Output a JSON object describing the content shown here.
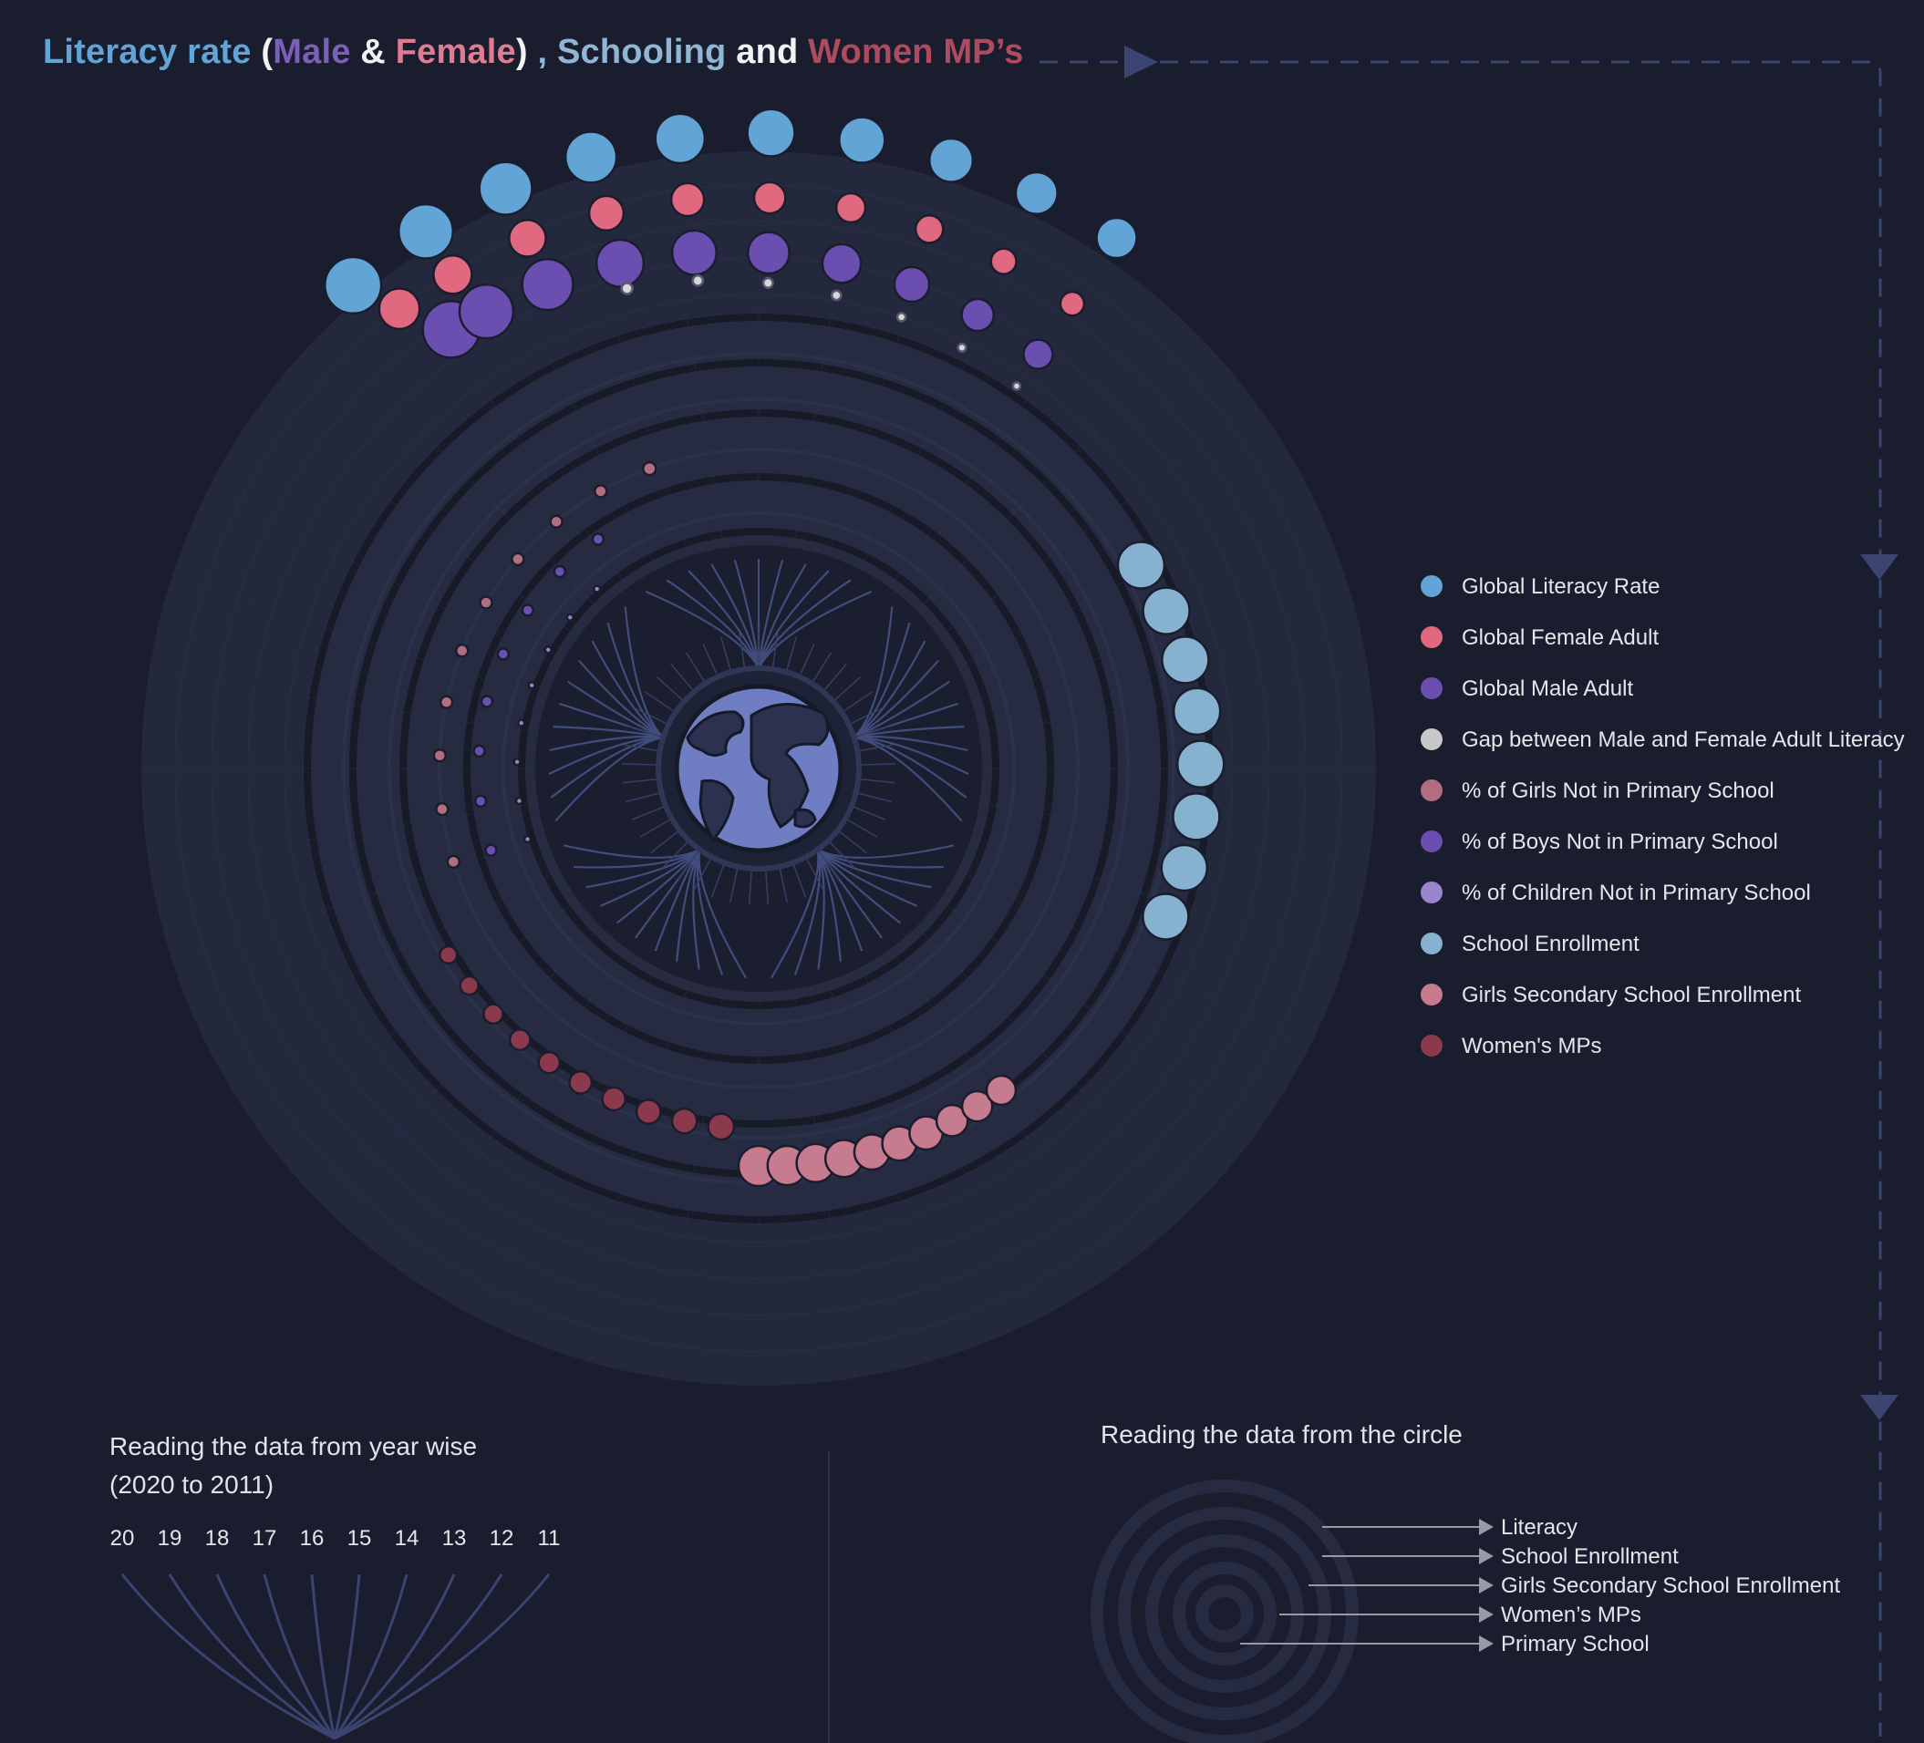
{
  "title": {
    "part1": "Literacy rate",
    "open": " (",
    "male": "Male",
    "amp": " & ",
    "female": "Female",
    "close": ")",
    "comma": " , ",
    "schooling": "Schooling",
    "and": " and ",
    "mps": "Women MP’s"
  },
  "colors": {
    "background": "#1a1d2d",
    "literacy": "#63a4d6",
    "female": "#e0697f",
    "male": "#6a4fb0",
    "gap": "#c8c8c8",
    "girls_not_primary": "#b36d80",
    "boys_not_primary": "#6a4fb0",
    "children_not_primary": "#9b85cf",
    "school_enrollment": "#86b2cf",
    "girls_secondary": "#c77b8e",
    "women_mps": "#8a3a4c",
    "ring": "#262b40"
  },
  "legend": [
    {
      "label": "Global Literacy Rate",
      "color": "#63a4d6"
    },
    {
      "label": "Global Female Adult",
      "color": "#e0697f"
    },
    {
      "label": "Global Male Adult",
      "color": "#6a4fb0"
    },
    {
      "label": "Gap between Male and Female  Adult Literacy",
      "color": "#c8c8c8"
    },
    {
      "label": "% of Girls Not in Primary School",
      "color": "#b36d80"
    },
    {
      "label": "% of Boys Not in Primary School",
      "color": "#6a4fb0"
    },
    {
      "label": "% of Children Not in Primary School",
      "color": "#9b85cf"
    },
    {
      "label": "School Enrollment",
      "color": "#86b2cf"
    },
    {
      "label": "Girls Secondary School Enrollment",
      "color": "#c77b8e"
    },
    {
      "label": "Women's MPs",
      "color": "#8a3a4c"
    }
  ],
  "chart_data": {
    "type": "radial-bubble",
    "years": [
      "2020",
      "2019",
      "2018",
      "2017",
      "2016",
      "2015",
      "2014",
      "2013",
      "2012",
      "2011"
    ],
    "series": [
      {
        "name": "Global Literacy Rate",
        "values": [
          87,
          86,
          86,
          86,
          86,
          85,
          85,
          84,
          84,
          84
        ]
      },
      {
        "name": "Global Female Adult",
        "values": [
          83,
          82,
          82,
          81,
          81,
          81,
          80,
          80,
          79,
          79
        ]
      },
      {
        "name": "Global Male Adult",
        "values": [
          90,
          90,
          90,
          89,
          89,
          89,
          89,
          88,
          88,
          88
        ]
      },
      {
        "name": "Gap between Male and Female  Adult Literacy",
        "values": [
          7,
          8,
          8,
          8,
          8,
          8,
          9,
          8,
          9,
          9
        ]
      },
      {
        "name": "% of Girls Not in Primary School",
        "values": [
          9,
          9,
          9,
          9,
          9,
          9,
          9,
          9,
          9,
          10
        ]
      },
      {
        "name": "% of Boys Not in Primary School",
        "values": [
          8,
          8,
          8,
          8,
          8,
          8,
          8,
          8,
          8,
          8
        ]
      },
      {
        "name": "% of Children Not in Primary School",
        "values": [
          8,
          8,
          8,
          8,
          8,
          8,
          8,
          8,
          8,
          9
        ]
      },
      {
        "name": "School Enrollment",
        "values": [
          90,
          90,
          90,
          90,
          90,
          90,
          89,
          89,
          89,
          89
        ]
      },
      {
        "name": "Girls Secondary School Enrollment",
        "values": [
          76,
          75,
          74,
          73,
          71,
          70,
          69,
          67,
          66,
          65
        ]
      },
      {
        "name": "Women's MPs",
        "values": [
          25,
          24,
          24,
          23,
          23,
          22,
          22,
          21,
          20,
          19
        ]
      }
    ]
  },
  "guide_left": {
    "title_line1": "Reading the data from year wise",
    "title_line2": "(2020 to 2011)",
    "years": [
      "20",
      "19",
      "18",
      "17",
      "16",
      "15",
      "14",
      "13",
      "12",
      "11"
    ]
  },
  "guide_right": {
    "title": "Reading the data from the circle",
    "rings": [
      "Literacy",
      "School Enrollment",
      "Girls Secondary School Enrollment",
      "Women’s MPs",
      "Primary School"
    ]
  }
}
